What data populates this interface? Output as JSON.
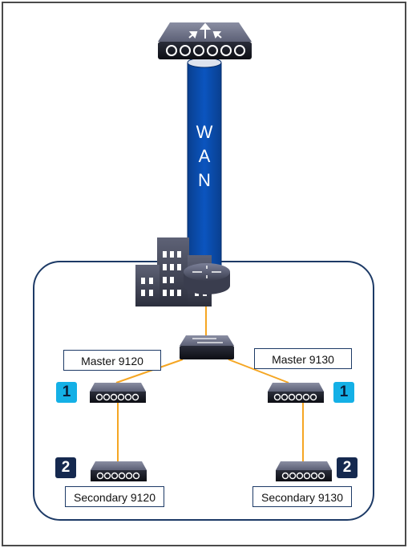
{
  "diagram": {
    "wan": {
      "label_letters": [
        "W",
        "A",
        "N"
      ],
      "color": "#0b4fb0"
    },
    "devices": {
      "top_router": "wan-edge-device",
      "site_building": "branch-site",
      "site_router": "site-router",
      "core_switch": "access-switch"
    },
    "access_points": [
      {
        "id": "master-9120",
        "label": "Master 9120",
        "badge": "1",
        "role": "primary"
      },
      {
        "id": "master-9130",
        "label": "Master 9130",
        "badge": "1",
        "role": "primary"
      },
      {
        "id": "secondary-9120",
        "label": "Secondary 9120",
        "badge": "2",
        "role": "secondary"
      },
      {
        "id": "secondary-9130",
        "label": "Secondary 9130",
        "badge": "2",
        "role": "secondary"
      }
    ],
    "colors": {
      "link": "#f5a623",
      "site_border": "#1d3a66",
      "badge_primary": "#14b0e6",
      "badge_secondary": "#15294f"
    }
  }
}
